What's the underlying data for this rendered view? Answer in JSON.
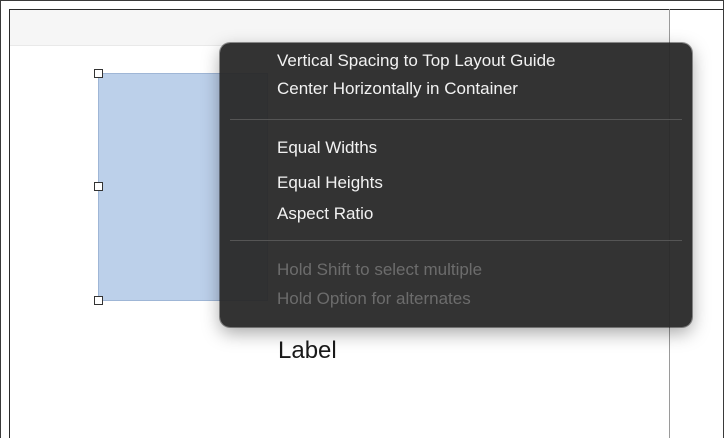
{
  "canvas": {
    "label_text": "Label"
  },
  "context_menu": {
    "groups": [
      {
        "items": [
          {
            "label": "Vertical Spacing to Top Layout Guide",
            "enabled": true
          },
          {
            "label": "Center Horizontally in Container",
            "enabled": true
          }
        ]
      },
      {
        "items": [
          {
            "label": "Equal Widths",
            "enabled": true
          },
          {
            "label": "Equal Heights",
            "enabled": true
          },
          {
            "label": "Aspect Ratio",
            "enabled": true
          }
        ]
      },
      {
        "items": [
          {
            "label": "Hold Shift to select multiple",
            "enabled": false
          },
          {
            "label": "Hold Option for alternates",
            "enabled": false
          }
        ]
      }
    ]
  },
  "colors": {
    "menu_background": "#282828",
    "menu_text": "#f2f2f2",
    "menu_text_disabled": "#6c6c6c",
    "selected_view_fill": "#bcd0ea"
  }
}
